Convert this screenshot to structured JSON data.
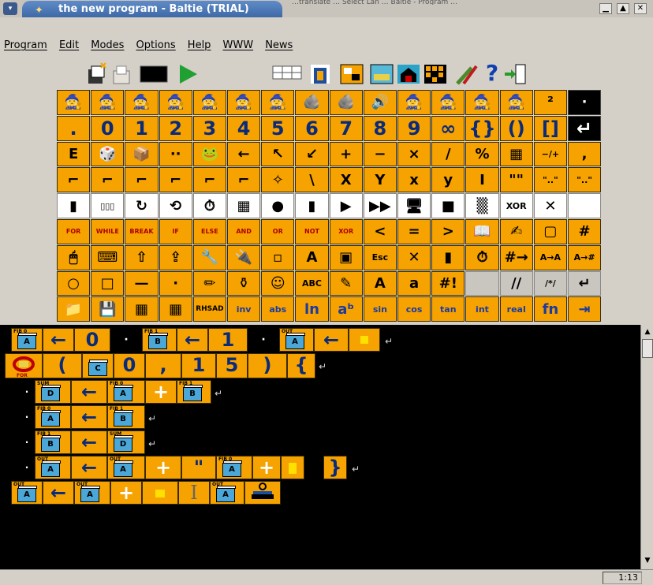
{
  "window": {
    "title": "the new program - Baltie (TRIAL)",
    "top_strip": "…translate … Select Lan … Baltie - Program …",
    "buttons": {
      "minimize": "▁",
      "maximize": "▲",
      "close": "✕"
    }
  },
  "menu": [
    "Program",
    "Edit",
    "Modes",
    "Options",
    "Help",
    "WWW",
    "News"
  ],
  "palette_rows": [
    [
      "🧙",
      "🧙",
      "🧙",
      "🧙",
      "🧙",
      "🧙",
      "🧙",
      "🪨",
      "🪨",
      "🔊",
      "🧙",
      "🧙",
      "🧙",
      "🧙",
      "²",
      "·"
    ],
    [
      ".",
      "0",
      "1",
      "2",
      "3",
      "4",
      "5",
      "6",
      "7",
      "8",
      "9",
      "∞",
      "{}",
      "()",
      "[]",
      "↵"
    ],
    [
      "E",
      "🎲",
      "📦",
      "··",
      "🐸",
      "←",
      "↖",
      "↙",
      "+",
      "−",
      "×",
      "/",
      "%",
      "▦",
      "−/+",
      ","
    ],
    [
      "⌐",
      "⌐",
      "⌐",
      "⌐",
      "⌐",
      "⌐",
      "✧",
      "\\",
      "X",
      "Y",
      "x",
      "y",
      "I",
      "\"\"",
      "\"..\"",
      "\"..\""
    ],
    [
      "▮",
      "▯▯▯",
      "↻",
      "⟲",
      "⏱",
      "▦",
      "●",
      "▮",
      "▶",
      "▶▶",
      "🖥",
      "■",
      "▒",
      "XOR",
      "✕",
      ""
    ],
    [
      "FOR",
      "WHILE",
      "BREAK",
      "IF",
      "ELSE",
      "AND",
      "OR",
      "NOT",
      "XOR",
      "<",
      "=",
      ">",
      "📖",
      "✍",
      "▢",
      "#"
    ],
    [
      "🖱",
      "⌨",
      "⇧",
      "⇪",
      "🔧",
      "🔌",
      "▫",
      "A",
      "▣",
      "Esc",
      "✕",
      "▮",
      "⏱",
      "#→",
      "A→A",
      "A→#"
    ],
    [
      "○",
      "□",
      "—",
      "·",
      "✏",
      "⚱",
      "☺",
      "ABC",
      "✎",
      "A",
      "a",
      "#!",
      "",
      "//",
      "/*/",
      "↵"
    ],
    [
      "📁",
      "💾",
      "▦",
      "▦",
      "RHSAD",
      "inv",
      "abs",
      "ln",
      "aᵇ",
      "sin",
      "cos",
      "tan",
      "int",
      "real",
      "fn",
      "⇥"
    ]
  ],
  "program": {
    "vars": {
      "fib0": "FIB 0",
      "fib1": "FIB 1",
      "out": "OUT",
      "sum": "SUM",
      "for": "FOR"
    },
    "letters": {
      "a": "A",
      "b": "B",
      "c": "C",
      "d": "D"
    },
    "symbols": {
      "arrow": "←",
      "zero": "0",
      "one": "1",
      "five": "5",
      "plus": "+",
      "comma": ",",
      "lparen": "(",
      "rparen": ")",
      "lbrace": "{",
      "rbrace": "}",
      "quote": "\"",
      "enter": "↵",
      "dot": "·"
    }
  },
  "status": {
    "position": "1:13"
  }
}
